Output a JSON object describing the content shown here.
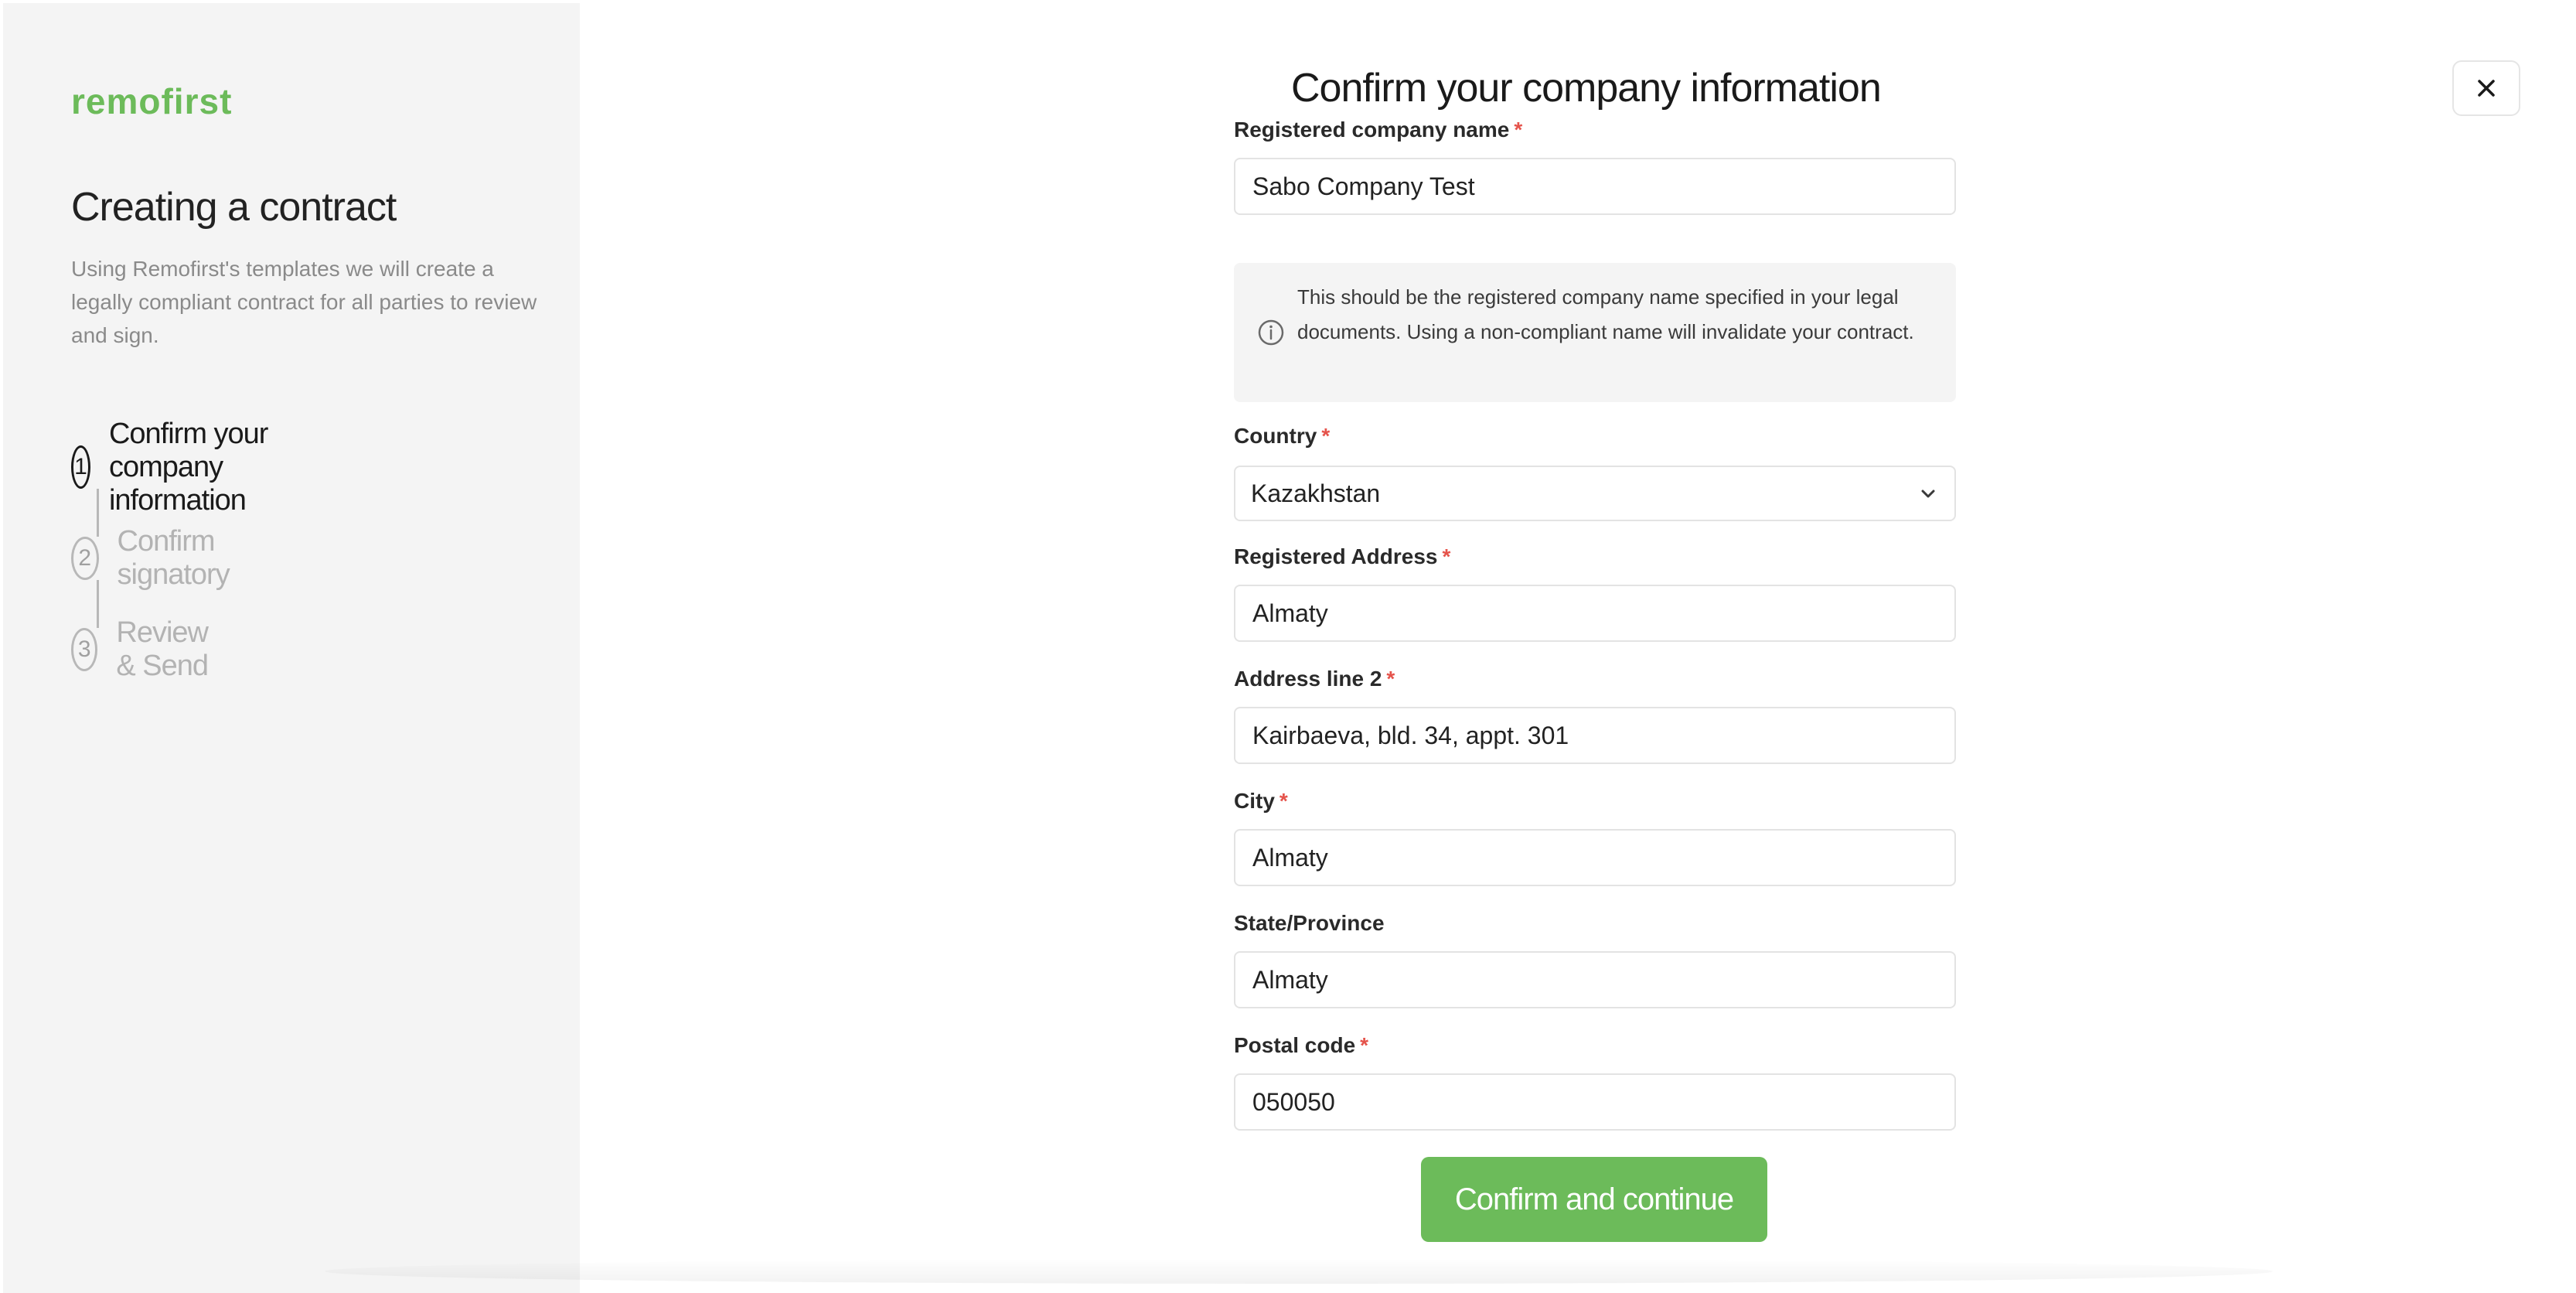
{
  "sidebar": {
    "logo": "remofirst",
    "title": "Creating a contract",
    "description": "Using Remofirst's templates we will create a legally compliant contract for all parties to review and sign.",
    "steps": [
      {
        "number": "1",
        "label": "Confirm your company information",
        "active": true
      },
      {
        "number": "2",
        "label": "Confirm signatory",
        "active": false
      },
      {
        "number": "3",
        "label": "Review & Send",
        "active": false
      }
    ]
  },
  "header": {
    "title": "Confirm your company information",
    "close_icon": "close-icon"
  },
  "form": {
    "company_name": {
      "label": "Registered company name",
      "required": "*",
      "value": "Sabo Company Test"
    },
    "info_note": "This should be the registered company name specified in your legal documents. Using a non-compliant name will invalidate your contract.",
    "country": {
      "label": "Country",
      "required": "*",
      "value": "Kazakhstan"
    },
    "address": {
      "label": "Registered Address",
      "required": "*",
      "value": "Almaty"
    },
    "address2": {
      "label": "Address line 2",
      "required": "*",
      "value": "Kairbaeva, bld. 34, appt. 301"
    },
    "city": {
      "label": "City",
      "required": "*",
      "value": "Almaty"
    },
    "state": {
      "label": "State/Province",
      "value": "Almaty"
    },
    "postal": {
      "label": "Postal code",
      "required": "*",
      "value": "050050"
    },
    "submit_label": "Confirm and continue"
  },
  "colors": {
    "accent": "#6cbb5a",
    "required": "#e5534b"
  }
}
